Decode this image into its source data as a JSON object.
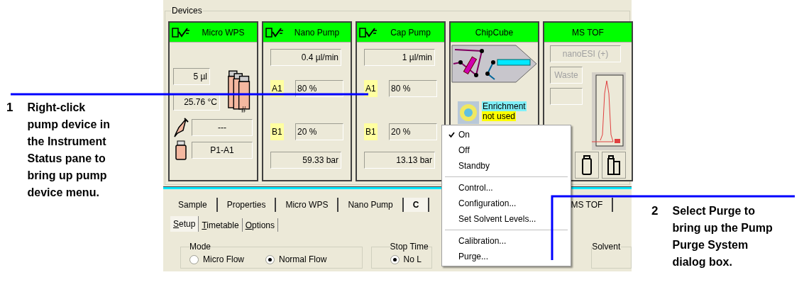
{
  "callouts": [
    {
      "number": "1",
      "text": "Right-click pump device in the Instrument Status pane to bring up pump device menu."
    },
    {
      "number": "2",
      "text": "Select Purge to bring up the Pump Purge System dialog box."
    }
  ],
  "devices_panel": {
    "title": "Devices",
    "devices": [
      {
        "kind": "sampler",
        "title": "Micro WPS",
        "logo": true,
        "volume": "5 µl",
        "vial_label": "#",
        "temperature": "25.76 °C",
        "injection": "---",
        "position": "P1-A1"
      },
      {
        "kind": "pump",
        "title": "Nano Pump",
        "logo": true,
        "flow": "0.4 µl/min",
        "channels": [
          {
            "label": "A1",
            "value": "80 %"
          },
          {
            "label": "B1",
            "value": "20 %"
          }
        ],
        "pressure": "59.33 bar"
      },
      {
        "kind": "pump",
        "title": "Cap Pump",
        "logo": true,
        "flow": "1 µl/min",
        "channels": [
          {
            "label": "A1",
            "value": "80 %"
          },
          {
            "label": "B1",
            "value": "20 %"
          }
        ],
        "pressure": "13.13 bar"
      },
      {
        "kind": "chip",
        "title": "ChipCube",
        "logo": false,
        "enrichment_label": "Enrichment",
        "enrichment_state": "not used"
      },
      {
        "kind": "ms",
        "title": "MS TOF",
        "logo": false,
        "fields": [
          {
            "value": "nanoESI (+)",
            "disabled": true
          },
          {
            "value": "Waste",
            "disabled": true
          }
        ]
      }
    ]
  },
  "tabs": [
    {
      "label": "Sample",
      "selected": false
    },
    {
      "label": "Properties",
      "selected": false
    },
    {
      "label": "Micro WPS",
      "selected": false
    },
    {
      "label": "Nano Pump",
      "selected": false
    },
    {
      "label": "C",
      "selected": true
    },
    {
      "label": "MS TOF",
      "selected": false
    }
  ],
  "subtabs": [
    {
      "label": "Setup",
      "selected": true
    },
    {
      "label": "Timetable",
      "selected": false
    },
    {
      "label": "Options",
      "selected": false
    }
  ],
  "mode_group": {
    "title": "Mode",
    "options": [
      {
        "label": "Micro Flow",
        "selected": false
      },
      {
        "label": "Normal Flow",
        "selected": true
      }
    ]
  },
  "stop_time_group": {
    "title": "Stop Time",
    "options": [
      {
        "label": "No L",
        "selected": true
      }
    ]
  },
  "solvent_group": {
    "title": "Solvent"
  },
  "context_menu": {
    "groups": [
      [
        {
          "label": "On",
          "checked": true
        },
        {
          "label": "Off",
          "checked": false
        },
        {
          "label": "Standby",
          "checked": false
        }
      ],
      [
        {
          "label": "Control...",
          "checked": false
        },
        {
          "label": "Configuration...",
          "checked": false
        },
        {
          "label": "Set Solvent Levels...",
          "checked": false
        }
      ],
      [
        {
          "label": "Calibration...",
          "checked": false
        },
        {
          "label": "Purge...",
          "checked": false
        }
      ]
    ]
  }
}
